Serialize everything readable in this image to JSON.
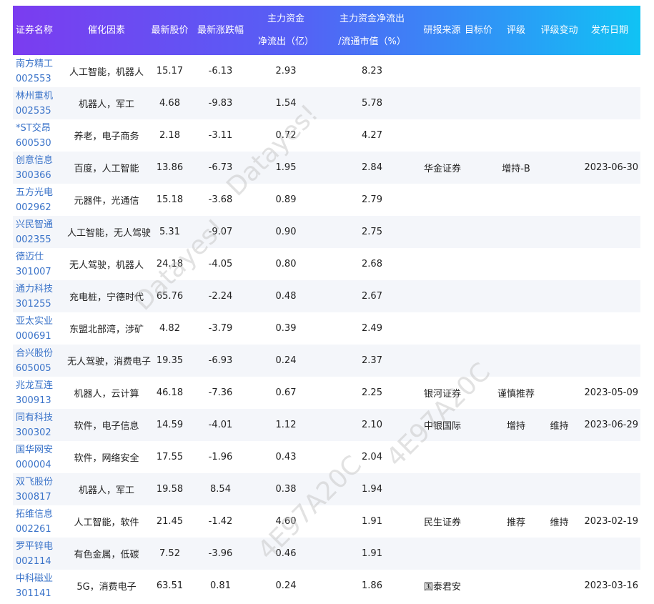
{
  "headers": {
    "name": "证券名称",
    "catalyst": "催化因素",
    "price": "最新股价",
    "change": "最新涨跌幅",
    "outflow_l1": "主力资金",
    "outflow_l2": "净流出（亿）",
    "ratio_l1": "主力资金净流出",
    "ratio_l2": "/流通市值（%）",
    "source": "研报来源",
    "target": "目标价",
    "rating": "评级",
    "rating_change": "评级变动",
    "date": "发布日期"
  },
  "rows": [
    {
      "name": "南方精工",
      "code": "002553",
      "catalyst": "人工智能，机器人",
      "price": "15.17",
      "change": "-6.13",
      "outflow": "2.93",
      "ratio": "8.23",
      "source": "",
      "target": "",
      "rating": "",
      "rating_change": "",
      "date": ""
    },
    {
      "name": "林州重机",
      "code": "002535",
      "catalyst": "机器人，军工",
      "price": "4.68",
      "change": "-9.83",
      "outflow": "1.54",
      "ratio": "5.78",
      "source": "",
      "target": "",
      "rating": "",
      "rating_change": "",
      "date": ""
    },
    {
      "name": "*ST交昂",
      "code": "600530",
      "catalyst": "养老，电子商务",
      "price": "2.18",
      "change": "-3.11",
      "outflow": "0.72",
      "ratio": "4.27",
      "source": "",
      "target": "",
      "rating": "",
      "rating_change": "",
      "date": ""
    },
    {
      "name": "创意信息",
      "code": "300366",
      "catalyst": "百度，人工智能",
      "price": "13.86",
      "change": "-6.73",
      "outflow": "1.95",
      "ratio": "2.84",
      "source": "华金证券",
      "target": "",
      "rating": "增持-B",
      "rating_change": "",
      "date": "2023-06-30"
    },
    {
      "name": "五方光电",
      "code": "002962",
      "catalyst": "元器件，光通信",
      "price": "15.18",
      "change": "-3.68",
      "outflow": "0.89",
      "ratio": "2.79",
      "source": "",
      "target": "",
      "rating": "",
      "rating_change": "",
      "date": ""
    },
    {
      "name": "兴民智通",
      "code": "002355",
      "catalyst": "人工智能，无人驾驶",
      "price": "5.31",
      "change": "-9.07",
      "outflow": "0.90",
      "ratio": "2.75",
      "source": "",
      "target": "",
      "rating": "",
      "rating_change": "",
      "date": ""
    },
    {
      "name": "德迈仕",
      "code": "301007",
      "catalyst": "无人驾驶，机器人",
      "price": "24.18",
      "change": "-4.05",
      "outflow": "0.80",
      "ratio": "2.68",
      "source": "",
      "target": "",
      "rating": "",
      "rating_change": "",
      "date": ""
    },
    {
      "name": "通力科技",
      "code": "301255",
      "catalyst": "充电桩，宁德时代",
      "price": "65.76",
      "change": "-2.24",
      "outflow": "0.48",
      "ratio": "2.67",
      "source": "",
      "target": "",
      "rating": "",
      "rating_change": "",
      "date": ""
    },
    {
      "name": "亚太实业",
      "code": "000691",
      "catalyst": "东盟北部湾，涉矿",
      "price": "4.82",
      "change": "-3.79",
      "outflow": "0.39",
      "ratio": "2.49",
      "source": "",
      "target": "",
      "rating": "",
      "rating_change": "",
      "date": ""
    },
    {
      "name": "合兴股份",
      "code": "605005",
      "catalyst": "无人驾驶，消费电子",
      "price": "19.35",
      "change": "-6.93",
      "outflow": "0.24",
      "ratio": "2.37",
      "source": "",
      "target": "",
      "rating": "",
      "rating_change": "",
      "date": ""
    },
    {
      "name": "兆龙互连",
      "code": "300913",
      "catalyst": "机器人，云计算",
      "price": "46.18",
      "change": "-7.36",
      "outflow": "0.67",
      "ratio": "2.25",
      "source": "银河证券",
      "target": "",
      "rating": "谨慎推荐",
      "rating_change": "",
      "date": "2023-05-09"
    },
    {
      "name": "同有科技",
      "code": "300302",
      "catalyst": "软件，电子信息",
      "price": "14.59",
      "change": "-4.01",
      "outflow": "1.12",
      "ratio": "2.10",
      "source": "中银国际",
      "target": "",
      "rating": "增持",
      "rating_change": "维持",
      "date": "2023-06-29"
    },
    {
      "name": "国华网安",
      "code": "000004",
      "catalyst": "软件，网络安全",
      "price": "17.55",
      "change": "-1.96",
      "outflow": "0.43",
      "ratio": "2.04",
      "source": "",
      "target": "",
      "rating": "",
      "rating_change": "",
      "date": ""
    },
    {
      "name": "双飞股份",
      "code": "300817",
      "catalyst": "机器人，军工",
      "price": "19.58",
      "change": "8.54",
      "outflow": "0.38",
      "ratio": "1.94",
      "source": "",
      "target": "",
      "rating": "",
      "rating_change": "",
      "date": ""
    },
    {
      "name": "拓维信息",
      "code": "002261",
      "catalyst": "人工智能，软件",
      "price": "21.45",
      "change": "-1.42",
      "outflow": "4.60",
      "ratio": "1.91",
      "source": "民生证券",
      "target": "",
      "rating": "推荐",
      "rating_change": "维持",
      "date": "2023-02-19"
    },
    {
      "name": "罗平锌电",
      "code": "002114",
      "catalyst": "有色金属，低碳",
      "price": "7.52",
      "change": "-3.96",
      "outflow": "0.46",
      "ratio": "1.91",
      "source": "",
      "target": "",
      "rating": "",
      "rating_change": "",
      "date": ""
    },
    {
      "name": "中科磁业",
      "code": "301141",
      "catalyst": "5G，消费电子",
      "price": "63.51",
      "change": "0.81",
      "outflow": "0.24",
      "ratio": "1.86",
      "source": "国泰君安",
      "target": "",
      "rating": "",
      "rating_change": "",
      "date": "2023-03-16"
    }
  ],
  "watermarks": [
    "Datayes!",
    "4E97A20C",
    "Datayes!",
    "4E97A20C"
  ]
}
